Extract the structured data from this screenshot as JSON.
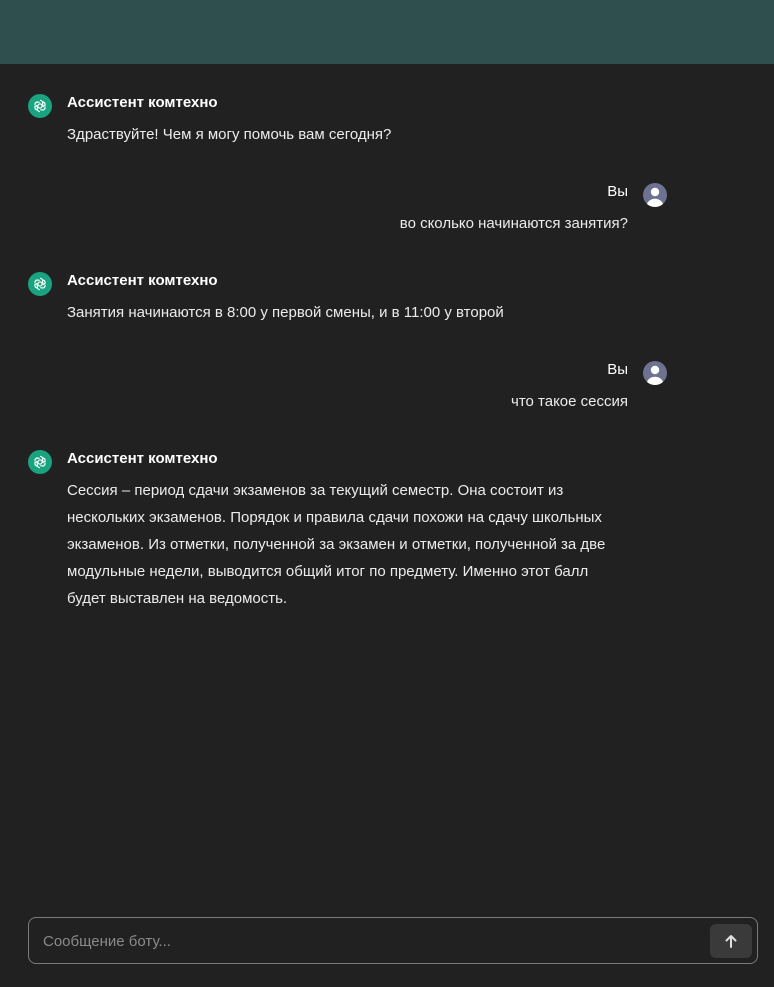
{
  "colors": {
    "header": "#2f4f4f",
    "background": "#212121",
    "bot_avatar": "#19a47f",
    "user_avatar": "#6c7290"
  },
  "messages": [
    {
      "role": "bot",
      "author": "Ассистент комтехно",
      "text": "Здраствуйте! Чем я могу помочь вам сегодня?"
    },
    {
      "role": "user",
      "author": "Вы",
      "text": "во сколько начинаются занятия?"
    },
    {
      "role": "bot",
      "author": "Ассистент комтехно",
      "text": "Занятия начинаются в 8:00 у первой смены, и в 11:00 у второй"
    },
    {
      "role": "user",
      "author": "Вы",
      "text": "что такое сессия"
    },
    {
      "role": "bot",
      "author": "Ассистент комтехно",
      "text": "Сессия – период сдачи экзаменов за текущий семестр. Она состоит из нескольких экзаменов. Порядок и правила сдачи похожи на сдачу школьных экзаменов. Из отметки, полученной за экзамен и отметки, полученной за две модульные недели, выводится общий итог по предмету. Именно этот балл будет выставлен на ведомость."
    }
  ],
  "composer": {
    "placeholder": "Сообщение боту...",
    "value": "",
    "send_icon": "arrow-up-icon"
  },
  "icons": {
    "bot": "openai-logo-icon",
    "user": "user-silhouette-icon"
  }
}
